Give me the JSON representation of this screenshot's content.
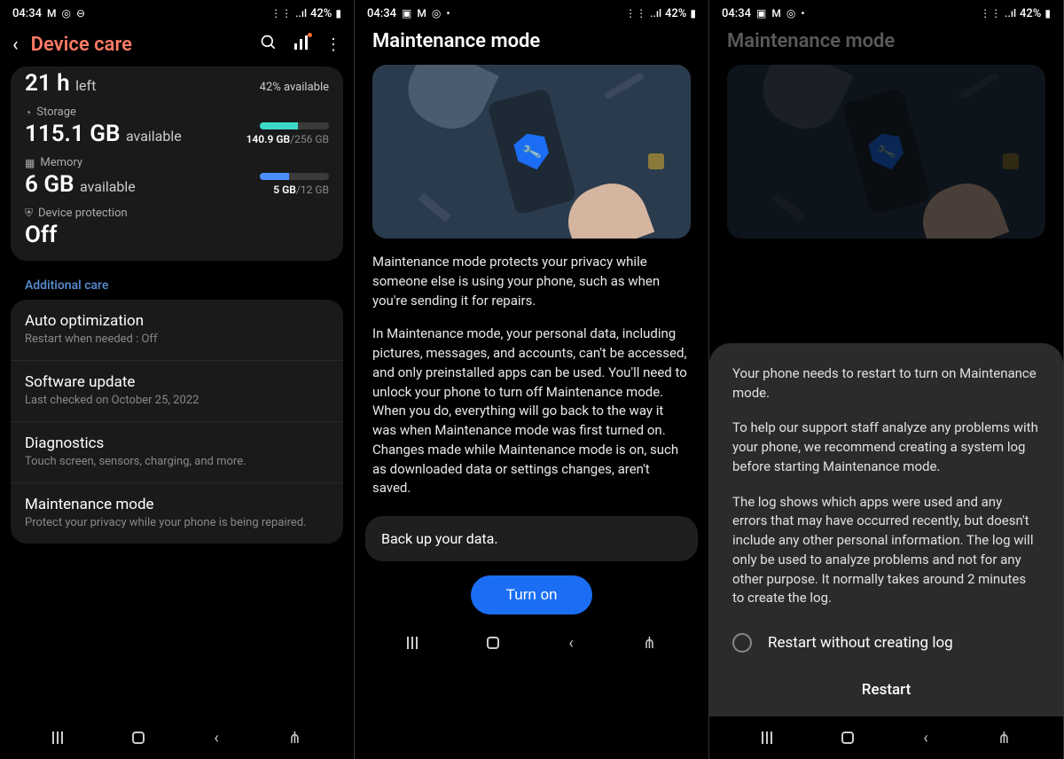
{
  "status": {
    "time": "04:34",
    "battery": "42%",
    "icons_left": [
      "M",
      "◎",
      "⊖"
    ],
    "icons_left_s2": [
      "▣",
      "M",
      "◎",
      "•"
    ],
    "icons_right": [
      "⋮⋮",
      "📶",
      "..ıl"
    ]
  },
  "screen1": {
    "title": "Device care",
    "battery_card": {
      "value": "21 h",
      "suffix": "left",
      "right": "42% available"
    },
    "storage": {
      "label": "Storage",
      "value": "115.1 GB",
      "suffix": "available",
      "used": "140.9 GB",
      "total": "/256 GB"
    },
    "memory": {
      "label": "Memory",
      "value": "6 GB",
      "suffix": "available",
      "used": "5 GB",
      "total": "/12 GB"
    },
    "protection": {
      "label": "Device protection",
      "value": "Off"
    },
    "additional_header": "Additional care",
    "items": [
      {
        "title": "Auto optimization",
        "sub": "Restart when needed : Off"
      },
      {
        "title": "Software update",
        "sub": "Last checked on October 25, 2022"
      },
      {
        "title": "Diagnostics",
        "sub": "Touch screen, sensors, charging, and more."
      },
      {
        "title": "Maintenance mode",
        "sub": "Protect your privacy while your phone is being repaired."
      }
    ]
  },
  "screen2": {
    "title": "Maintenance mode",
    "p1": "Maintenance mode protects your privacy while someone else is using your phone, such as when you're sending it for repairs.",
    "p2": "In Maintenance mode, your personal data, including pictures, messages, and accounts, can't be accessed, and only preinstalled apps can be used. You'll need to unlock your phone to turn off Maintenance mode. When you do, everything will go back to the way it was when Maintenance mode was first turned on. Changes made while Maintenance mode is on, such as downloaded data or settings changes, aren't saved.",
    "backup": "Back up your data.",
    "button": "Turn on"
  },
  "screen3": {
    "title": "Maintenance mode",
    "dialog": {
      "p1": "Your phone needs to restart to turn on Maintenance mode.",
      "p2": "To help our support staff analyze any problems with your phone, we recommend creating a system log before starting Maintenance mode.",
      "p3": "The log shows which apps were used and any errors that may have occurred recently, but doesn't include any other personal information. The log will only be used to analyze problems and not for any other purpose. It normally takes around 2 minutes to create the log.",
      "radio": "Restart without creating log",
      "button": "Restart"
    }
  }
}
